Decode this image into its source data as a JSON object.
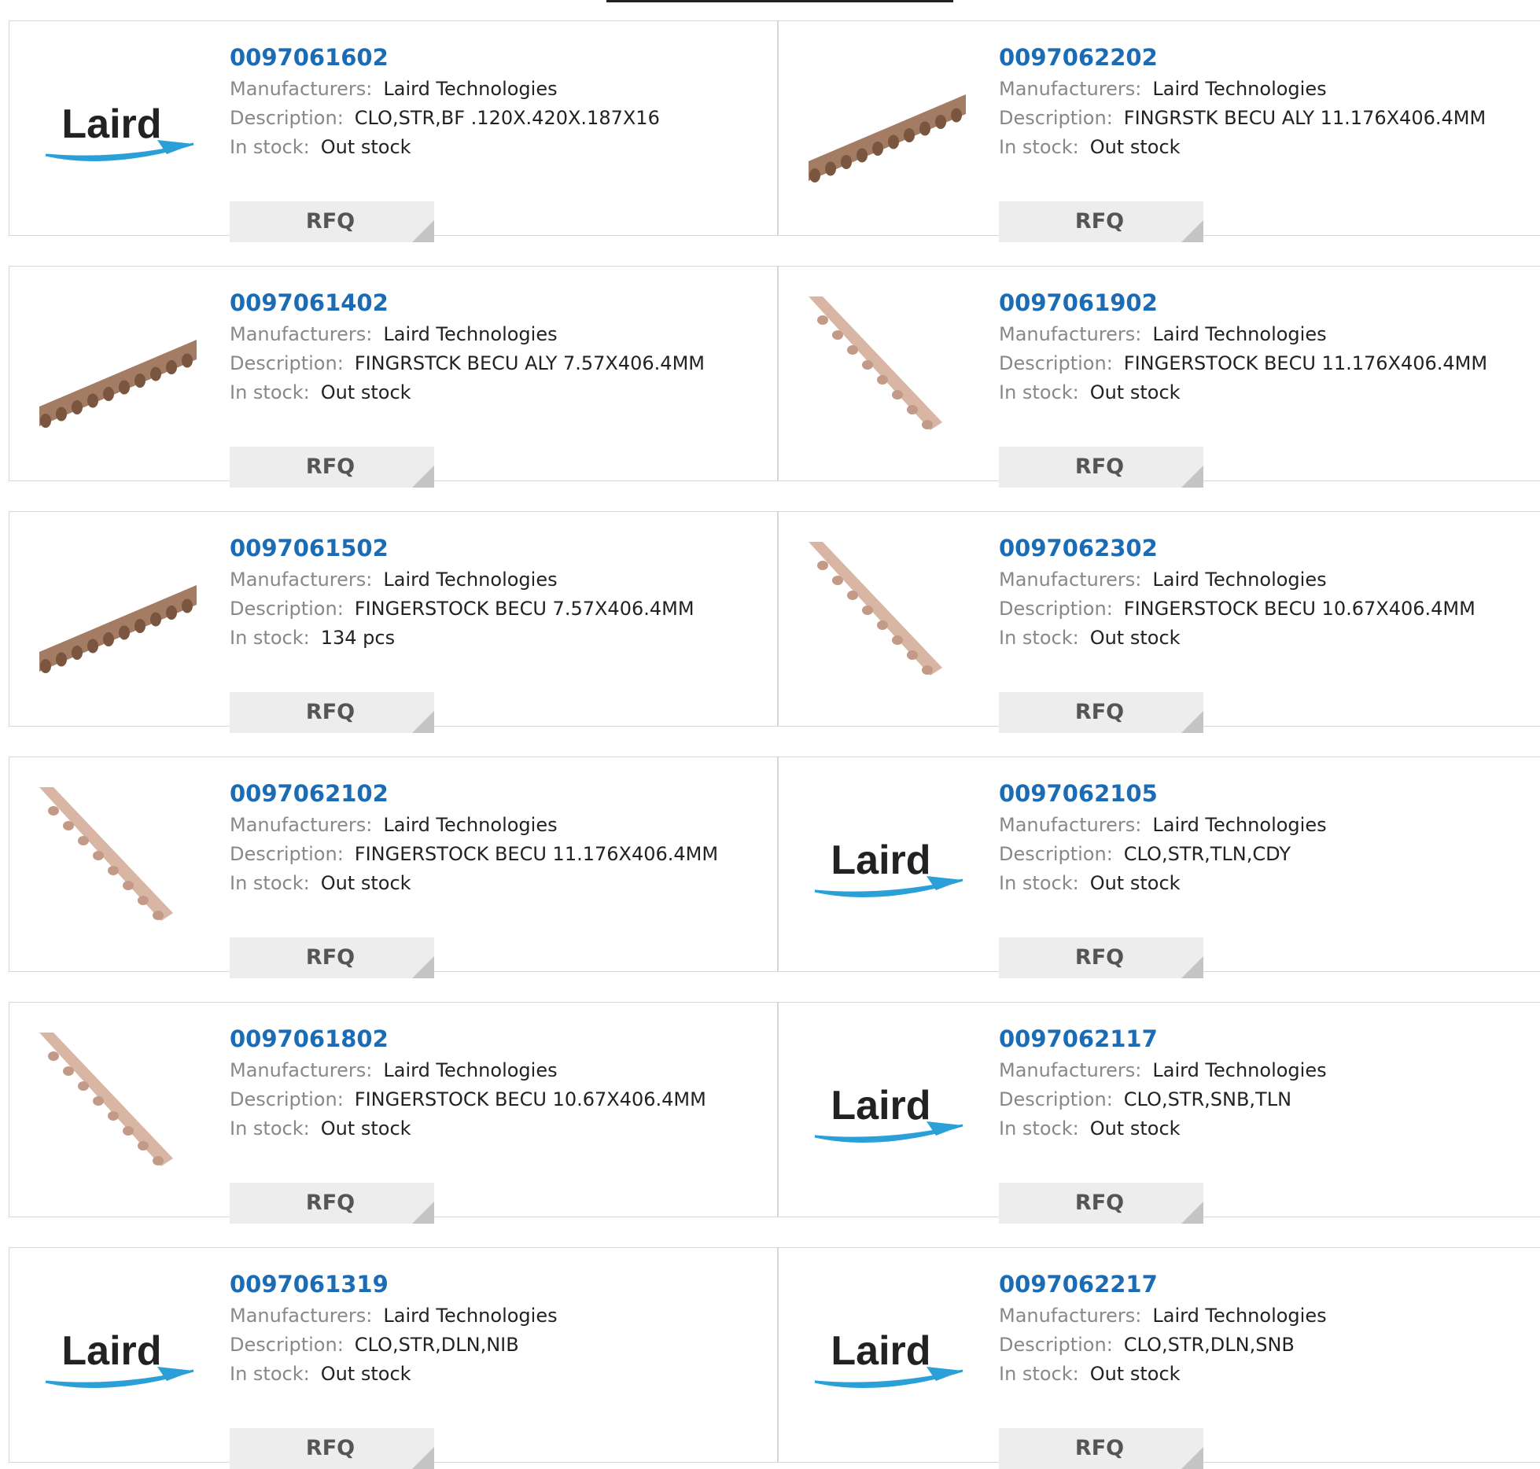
{
  "labels": {
    "manufacturers": "Manufacturers:",
    "description": "Description:",
    "in_stock": "In stock:",
    "rfq": "RFQ"
  },
  "logo_text": "Laird",
  "colors": {
    "part_number": "#1c6bb5",
    "rfq_bg": "#ededed",
    "border": "#d6d6d6"
  },
  "products": [
    {
      "part_number": "0097061602",
      "manufacturer": "Laird Technologies",
      "description": "CLO,STR,BF .120X.420X.187X16",
      "stock": "Out stock",
      "image": "laird-logo"
    },
    {
      "part_number": "0097062202",
      "manufacturer": "Laird Technologies",
      "description": "FINGRSTK BECU ALY 11.176X406.4MM",
      "stock": "Out stock",
      "image": "fingerstock-dark-icon"
    },
    {
      "part_number": "0097061402",
      "manufacturer": "Laird Technologies",
      "description": "FINGRSTCK BECU ALY 7.57X406.4MM",
      "stock": "Out stock",
      "image": "fingerstock-dark-icon"
    },
    {
      "part_number": "0097061902",
      "manufacturer": "Laird Technologies",
      "description": "FINGERSTOCK BECU 11.176X406.4MM",
      "stock": "Out stock",
      "image": "fingerstock-light-icon"
    },
    {
      "part_number": "0097061502",
      "manufacturer": "Laird Technologies",
      "description": "FINGERSTOCK BECU 7.57X406.4MM",
      "stock": "134 pcs",
      "image": "fingerstock-dark-icon"
    },
    {
      "part_number": "0097062302",
      "manufacturer": "Laird Technologies",
      "description": "FINGERSTOCK BECU 10.67X406.4MM",
      "stock": "Out stock",
      "image": "fingerstock-light-icon"
    },
    {
      "part_number": "0097062102",
      "manufacturer": "Laird Technologies",
      "description": "FINGERSTOCK BECU 11.176X406.4MM",
      "stock": "Out stock",
      "image": "fingerstock-light-icon"
    },
    {
      "part_number": "0097062105",
      "manufacturer": "Laird Technologies",
      "description": "CLO,STR,TLN,CDY",
      "stock": "Out stock",
      "image": "laird-logo"
    },
    {
      "part_number": "0097061802",
      "manufacturer": "Laird Technologies",
      "description": "FINGERSTOCK BECU 10.67X406.4MM",
      "stock": "Out stock",
      "image": "fingerstock-light-icon"
    },
    {
      "part_number": "0097062117",
      "manufacturer": "Laird Technologies",
      "description": "CLO,STR,SNB,TLN",
      "stock": "Out stock",
      "image": "laird-logo"
    },
    {
      "part_number": "0097061319",
      "manufacturer": "Laird Technologies",
      "description": "CLO,STR,DLN,NIB",
      "stock": "Out stock",
      "image": "laird-logo"
    },
    {
      "part_number": "0097062217",
      "manufacturer": "Laird Technologies",
      "description": "CLO,STR,DLN,SNB",
      "stock": "Out stock",
      "image": "laird-logo"
    }
  ]
}
